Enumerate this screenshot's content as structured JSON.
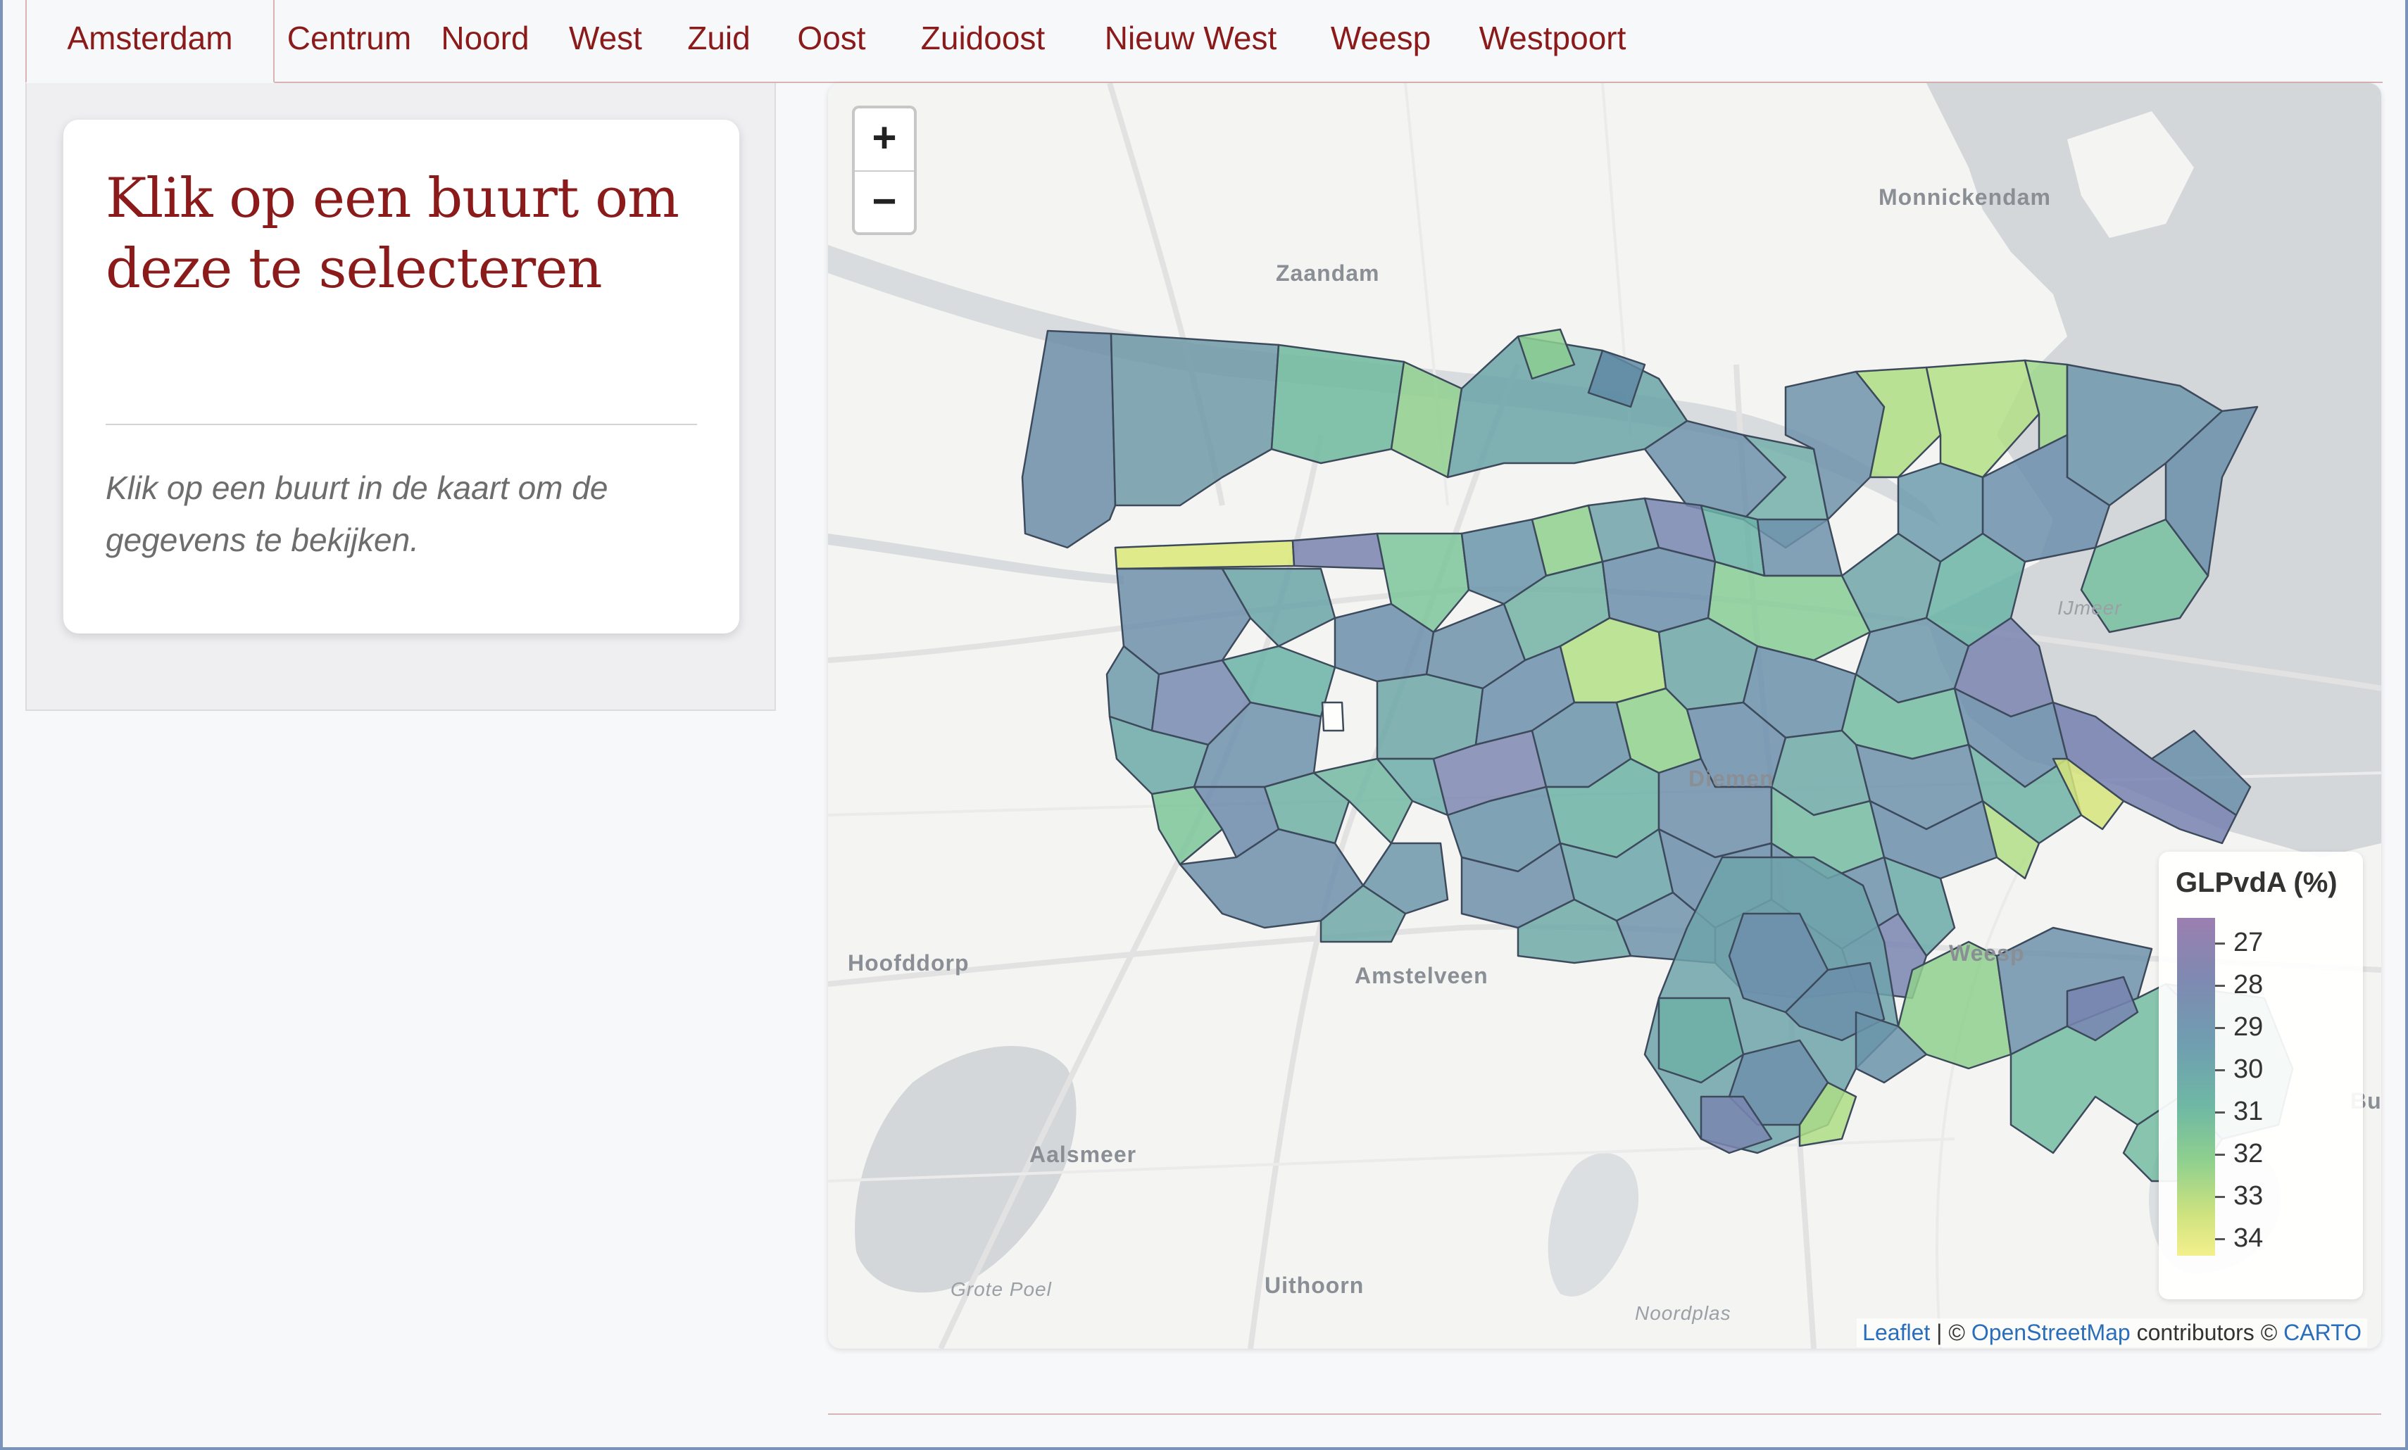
{
  "tabs": [
    "Amsterdam",
    "Centrum",
    "Noord",
    "West",
    "Zuid",
    "Oost",
    "Zuidoost",
    "Nieuw West",
    "Weesp",
    "Westpoort"
  ],
  "active_tab": "Amsterdam",
  "sidebar": {
    "title": "Klik op een buurt om deze te selecteren",
    "text": "Klik op een buurt in de kaart om de gegevens te bekijken."
  },
  "map": {
    "zoom_in": "+",
    "zoom_out": "−",
    "places": {
      "zaandam": "Zaandam",
      "monnickendam": "Monnickendam",
      "ijmeer": "IJmeer",
      "diemen": "Diemen",
      "hoofddorp": "Hoofddorp",
      "amstelveen": "Amstelveen",
      "weesp": "Weesp",
      "bussum": "Bussu",
      "aalsmeer": "Aalsmeer",
      "grote_poel": "Grote Poel",
      "uithoorn": "Uithoorn",
      "noordplas": "Noordplas"
    },
    "legend": {
      "title": "GLPvdA (%)",
      "ticks": [
        "27",
        "28",
        "29",
        "30",
        "31",
        "32",
        "33",
        "34"
      ],
      "colors": [
        "#9b7fb1",
        "#7f89b1",
        "#6f9fb0",
        "#6fb8a4",
        "#8fd08e",
        "#cfe37f",
        "#f3f08c"
      ]
    },
    "attribution": {
      "leaflet": "Leaflet",
      "sep": " | © ",
      "osm": "OpenStreetMap",
      "contributors": " contributors © ",
      "carto": "CARTO"
    }
  }
}
